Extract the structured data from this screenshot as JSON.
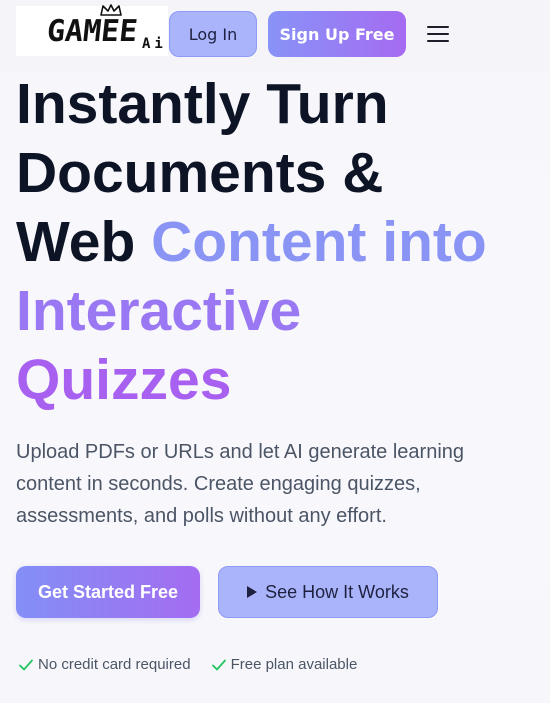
{
  "header": {
    "logo_text": "GAMEE",
    "logo_sub": "Ai",
    "login_label": "Log In",
    "signup_label": "Sign Up Free",
    "menu_icon": "hamburger-icon"
  },
  "hero": {
    "headline_line1": "Instantly Turn",
    "headline_line2": "Documents &",
    "headline_line3_dark": "Web ",
    "headline_line3_grad": "Content into",
    "headline_line4": "Interactive",
    "headline_line5": "Quizzes",
    "subtitle": "Upload PDFs or URLs and let AI generate learning content in seconds. Create engaging quizzes, assessments, and polls without any effort.",
    "primary_cta": "Get Started Free",
    "secondary_cta": "See How It Works",
    "secondary_icon": "play-icon"
  },
  "features": [
    {
      "label": "No credit card required",
      "icon": "check-icon"
    },
    {
      "label": "Free plan available",
      "icon": "check-icon"
    }
  ],
  "colors": {
    "accent_start": "#838ff6",
    "accent_end": "#a46cf1",
    "headline_dark": "#0d1426",
    "check_green": "#22c55e"
  }
}
